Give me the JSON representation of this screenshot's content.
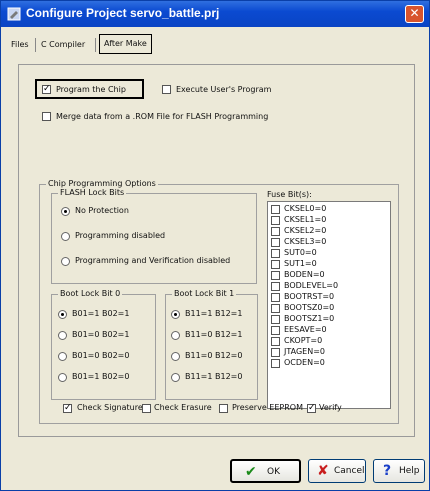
{
  "window": {
    "title": "Configure Project servo_battle.prj",
    "close_symbol": "✕"
  },
  "tabs": [
    {
      "label": "Files"
    },
    {
      "label": "C Compiler"
    },
    {
      "label": "After Make"
    }
  ],
  "after_make": {
    "program_the_chip": {
      "label": "Program the Chip",
      "checked": true
    },
    "execute_users_program": {
      "label": "Execute User's Program",
      "checked": false
    },
    "merge_rom": {
      "label": "Merge data from a .ROM File for FLASH Programming",
      "checked": false
    }
  },
  "chip_options": {
    "title": "Chip Programming Options",
    "flash_lock_bits": {
      "title": "FLASH Lock Bits",
      "options": [
        {
          "label": "No Protection",
          "selected": true
        },
        {
          "label": "Programming disabled",
          "selected": false
        },
        {
          "label": "Programming and Verification disabled",
          "selected": false
        }
      ]
    },
    "boot_lock_bit0": {
      "title": "Boot Lock Bit 0",
      "options": [
        {
          "label": "B01=1 B02=1",
          "selected": true
        },
        {
          "label": "B01=0 B02=1",
          "selected": false
        },
        {
          "label": "B01=0 B02=0",
          "selected": false
        },
        {
          "label": "B01=1 B02=0",
          "selected": false
        }
      ]
    },
    "boot_lock_bit1": {
      "title": "Boot Lock Bit 1",
      "options": [
        {
          "label": "B11=1 B12=1",
          "selected": true
        },
        {
          "label": "B11=0 B12=1",
          "selected": false
        },
        {
          "label": "B11=0 B12=0",
          "selected": false
        },
        {
          "label": "B11=1 B12=0",
          "selected": false
        }
      ]
    },
    "fuse_bits": {
      "title": "Fuse Bit(s):",
      "items": [
        "CKSEL0=0",
        "CKSEL1=0",
        "CKSEL2=0",
        "CKSEL3=0",
        "SUT0=0",
        "SUT1=0",
        "BODEN=0",
        "BODLEVEL=0",
        "BOOTRST=0",
        "BOOTSZ0=0",
        "BOOTSZ1=0",
        "EESAVE=0",
        "CKOPT=0",
        "JTAGEN=0",
        "OCDEN=0"
      ]
    },
    "checks": [
      {
        "label": "Check Signature",
        "checked": true
      },
      {
        "label": "Check Erasure",
        "checked": false
      },
      {
        "label": "Preserve EEPROM",
        "checked": false
      },
      {
        "label": "Verify",
        "checked": true
      }
    ]
  },
  "buttons": {
    "ok": {
      "label": "OK",
      "icon": "checkmark-icon",
      "color": "#1a8a1a"
    },
    "cancel": {
      "label": "Cancel",
      "icon": "x-icon",
      "color": "#c81e1e"
    },
    "help": {
      "label": "Help",
      "icon": "question-icon",
      "color": "#1a3fc8"
    }
  }
}
